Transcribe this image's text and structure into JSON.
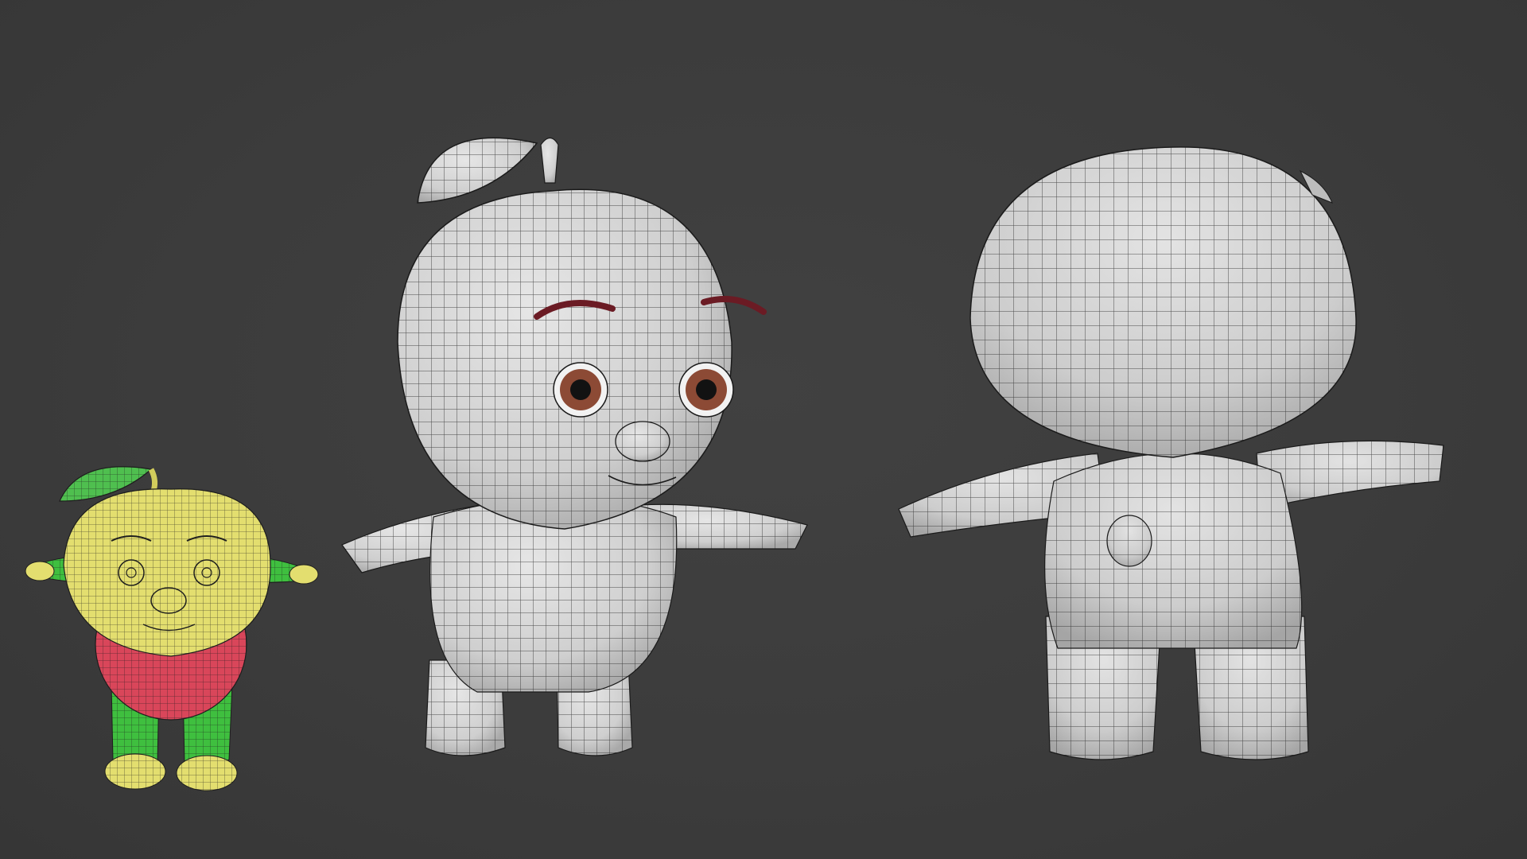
{
  "scene": {
    "background_color": "#3c3c3c",
    "models": [
      {
        "id": "small",
        "icon": "colored-uv-preview-character",
        "colors": {
          "head": "#e3de6f",
          "leaf": "#4fbf4f",
          "body": "#d9465a",
          "limbs": "#3fbf3f",
          "feet": "#e3de6f"
        }
      },
      {
        "id": "front",
        "icon": "wireframe-front-view-character",
        "colors": {
          "surface": "#d7d7d7",
          "wire": "#1f1f1f",
          "eyebrow": "#6b1b24",
          "iris": "#8c4a35"
        }
      },
      {
        "id": "back",
        "icon": "wireframe-back-view-character",
        "colors": {
          "surface": "#d4d4d4",
          "wire": "#1f1f1f"
        }
      }
    ]
  }
}
